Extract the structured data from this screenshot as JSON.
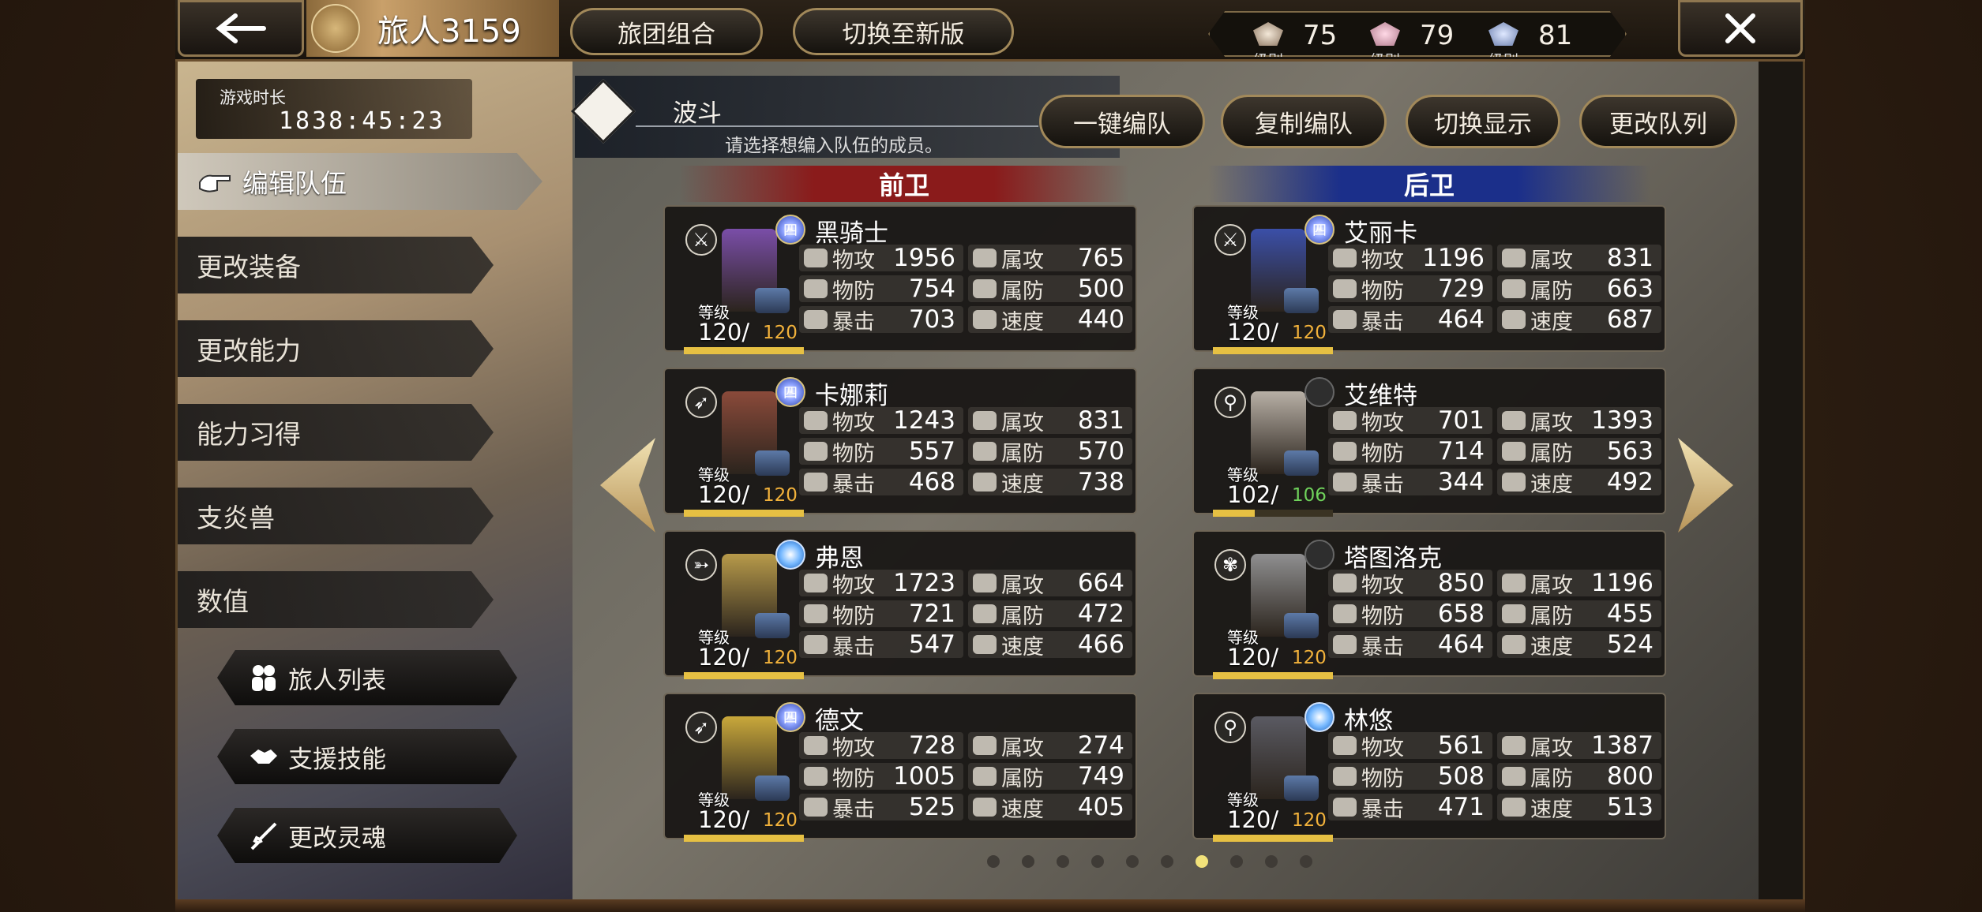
{
  "player": {
    "name": "旅人3159"
  },
  "top_buttons": {
    "team_combo": "旅团组合",
    "switch_version": "切换至新版"
  },
  "levels": [
    {
      "label": "级别",
      "value": "75"
    },
    {
      "label": "级别",
      "value": "79"
    },
    {
      "label": "级别",
      "value": "81"
    }
  ],
  "playtime": {
    "label": "游戏时长",
    "value": "1838:45:23"
  },
  "menu": [
    {
      "label": "编辑队伍",
      "active": true
    },
    {
      "label": "更改装备"
    },
    {
      "label": "更改能力"
    },
    {
      "label": "能力习得"
    },
    {
      "label": "支炎兽"
    },
    {
      "label": "数值"
    }
  ],
  "pills": [
    {
      "label": "旅人列表",
      "icon": "people-icon"
    },
    {
      "label": "支援技能",
      "icon": "handshake-icon"
    },
    {
      "label": "更改灵魂",
      "icon": "sword-icon"
    }
  ],
  "party": {
    "name": "波斗",
    "hint": "请选择想编入队伍的成员。"
  },
  "actions": {
    "auto": "一键编队",
    "copy": "复制编队",
    "toggle": "切换显示",
    "order": "更改队列"
  },
  "columns": {
    "front": "前卫",
    "rear": "后卫"
  },
  "level_label": "等级",
  "stat_labels": {
    "patk": "物攻",
    "matk": "属攻",
    "pdef": "物防",
    "mdef": "属防",
    "crit": "暴击",
    "spd": "速度"
  },
  "front": [
    {
      "name": "黑骑士",
      "weapon": "sword-icon",
      "job": "emblem",
      "job_text": "四",
      "lv": "120",
      "max": "120",
      "xp": 1.0,
      "patk": "1956",
      "matk": "765",
      "pdef": "754",
      "mdef": "500",
      "crit": "703",
      "spd": "440",
      "color": "#7a4ea8"
    },
    {
      "name": "卡娜莉",
      "weapon": "spear-icon",
      "job": "emblem",
      "job_text": "四",
      "lv": "120",
      "max": "120",
      "xp": 1.0,
      "patk": "1243",
      "matk": "831",
      "pdef": "557",
      "mdef": "570",
      "crit": "468",
      "spd": "738",
      "color": "#8a4a3a"
    },
    {
      "name": "弗恩",
      "weapon": "bow-icon",
      "job": "blue",
      "job_text": "",
      "lv": "120",
      "max": "120",
      "xp": 1.0,
      "patk": "1723",
      "matk": "664",
      "pdef": "721",
      "mdef": "472",
      "crit": "547",
      "spd": "466",
      "color": "#b79a4a"
    },
    {
      "name": "德文",
      "weapon": "spear-icon",
      "job": "emblem",
      "job_text": "四",
      "lv": "120",
      "max": "120",
      "xp": 1.0,
      "patk": "728",
      "matk": "274",
      "pdef": "1005",
      "mdef": "749",
      "crit": "525",
      "spd": "405",
      "color": "#c9a83b"
    }
  ],
  "rear": [
    {
      "name": "艾丽卡",
      "weapon": "sword-icon",
      "job": "emblem",
      "job_text": "四",
      "lv": "120",
      "max": "120",
      "xp": 1.0,
      "patk": "1196",
      "matk": "831",
      "pdef": "729",
      "mdef": "663",
      "crit": "464",
      "spd": "687",
      "color": "#3b4fa8"
    },
    {
      "name": "艾维特",
      "weapon": "staff-icon",
      "job": "dark",
      "job_text": "",
      "lv": "102",
      "max": "106",
      "xp": 0.35,
      "patk": "701",
      "matk": "1393",
      "pdef": "714",
      "mdef": "563",
      "crit": "344",
      "spd": "492",
      "color": "#b8b0a6"
    },
    {
      "name": "塔图洛克",
      "weapon": "fan-icon",
      "job": "dark",
      "job_text": "",
      "lv": "120",
      "max": "120",
      "xp": 1.0,
      "patk": "850",
      "matk": "1196",
      "pdef": "658",
      "mdef": "455",
      "crit": "464",
      "spd": "524",
      "color": "#8f8f90"
    },
    {
      "name": "林悠",
      "weapon": "staff-icon",
      "job": "blue",
      "job_text": "",
      "lv": "120",
      "max": "120",
      "xp": 1.0,
      "patk": "561",
      "matk": "1387",
      "pdef": "508",
      "mdef": "800",
      "crit": "471",
      "spd": "513",
      "color": "#5a5a62"
    }
  ],
  "page_dots": {
    "count": 10,
    "active": 6
  }
}
